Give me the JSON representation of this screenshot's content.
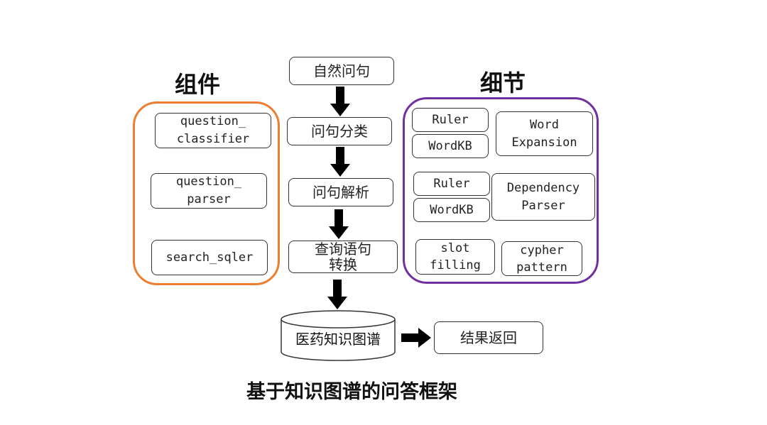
{
  "headings": {
    "components": "组件",
    "details": "细节"
  },
  "components": [
    "question_\nclassifier",
    "question_\nparser",
    "search_sqler"
  ],
  "pipeline": [
    "自然问句",
    "问句分类",
    "问句解析",
    "查询语句\n转换"
  ],
  "database": "医药知识图谱",
  "result": "结果返回",
  "details": {
    "row1": {
      "rules": [
        "Ruler",
        "WordKB"
      ],
      "method": "Word\nExpansion"
    },
    "row2": {
      "rules": [
        "Ruler",
        "WordKB"
      ],
      "method": "Dependency\nParser"
    },
    "row3": {
      "left": "slot\nfilling",
      "right": "cypher\npattern"
    }
  },
  "caption": "基于知识图谱的问答框架",
  "colors": {
    "components_border": "#ED7D31",
    "details_border": "#7030A0",
    "arrow": "#000000"
  }
}
